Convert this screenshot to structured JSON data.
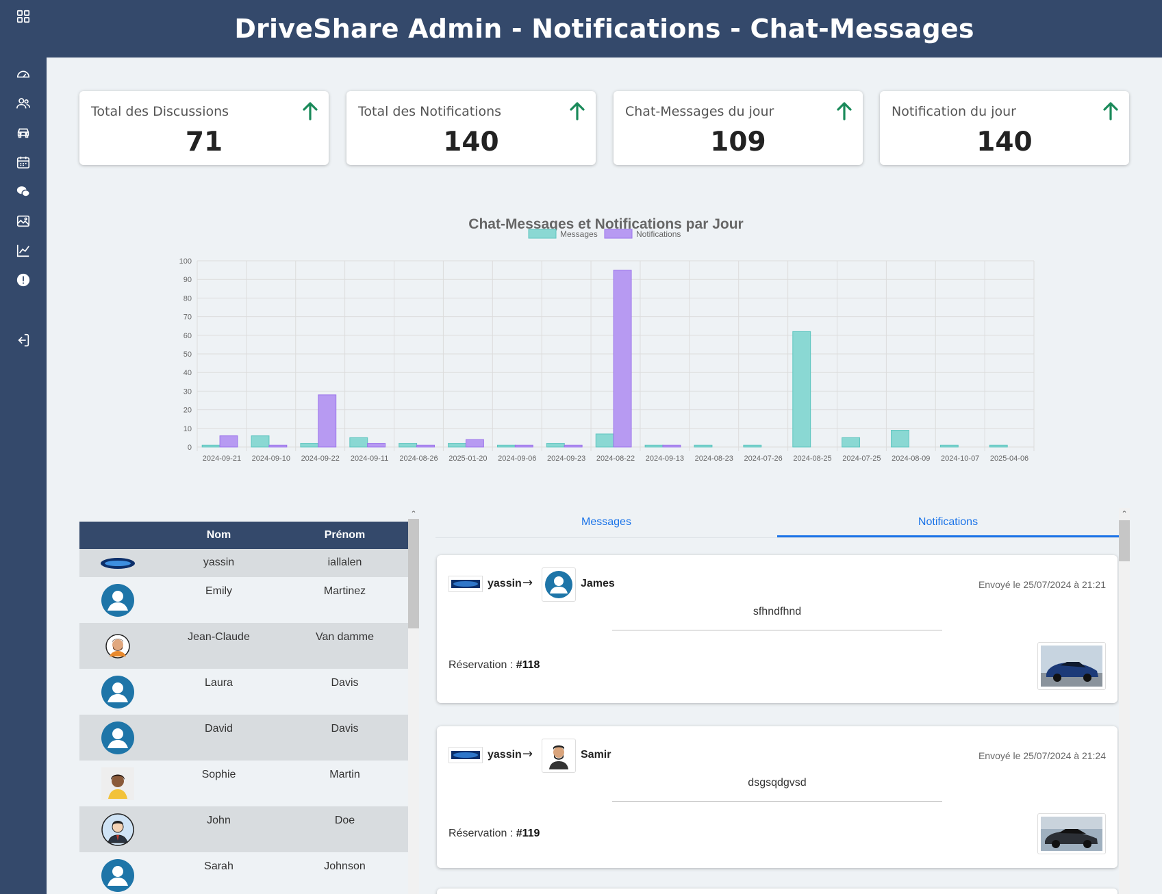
{
  "header": {
    "title": "DriveShare Admin - Notifications - Chat-Messages"
  },
  "sidebar": {
    "items": [
      {
        "icon": "grid-icon"
      },
      {
        "icon": "dashboard-icon"
      },
      {
        "icon": "users-icon"
      },
      {
        "icon": "car-icon"
      },
      {
        "icon": "calendar-icon"
      },
      {
        "icon": "chat-icon"
      },
      {
        "icon": "gallery-icon"
      },
      {
        "icon": "chart-icon"
      },
      {
        "icon": "alert-icon"
      },
      {
        "icon": "logout-icon"
      }
    ]
  },
  "stats": [
    {
      "label": "Total des Discussions",
      "value": "71"
    },
    {
      "label": "Total des Notifications",
      "value": "140"
    },
    {
      "label": "Chat-Messages du jour",
      "value": "109"
    },
    {
      "label": "Notification du jour",
      "value": "140"
    }
  ],
  "colors": {
    "header": "#34496b",
    "arrow_up": "#1a8a5a",
    "messages": "#8ad8d3",
    "notifications": "#b79af2",
    "tab_accent": "#1a73e8"
  },
  "chart_data": {
    "type": "bar",
    "title": "Chat-Messages et Notifications par Jour",
    "categories": [
      "2024-09-21",
      "2024-09-10",
      "2024-09-22",
      "2024-09-11",
      "2024-08-26",
      "2025-01-20",
      "2024-09-06",
      "2024-09-23",
      "2024-08-22",
      "2024-09-13",
      "2024-08-23",
      "2024-07-26",
      "2024-08-25",
      "2024-07-25",
      "2024-08-09",
      "2024-10-07",
      "2025-04-06"
    ],
    "series": [
      {
        "name": "Messages",
        "values": [
          1,
          6,
          2,
          5,
          2,
          2,
          1,
          2,
          7,
          1,
          1,
          1,
          62,
          5,
          9,
          1,
          1
        ]
      },
      {
        "name": "Notifications",
        "values": [
          6,
          1,
          28,
          2,
          1,
          4,
          1,
          1,
          95,
          1,
          0,
          0,
          0,
          0,
          0,
          0,
          0
        ]
      }
    ],
    "ylim": [
      0,
      100
    ],
    "yticks": [
      "0",
      "10",
      "20",
      "30",
      "40",
      "50",
      "60",
      "70",
      "80",
      "90",
      "100"
    ],
    "grid": true,
    "legend": "top-center"
  },
  "users_table": {
    "headers": {
      "avatar": "",
      "nom": "Nom",
      "prenom": "Prénom"
    },
    "rows": [
      {
        "nom": "yassin",
        "prenom": "iallalen",
        "avatar": "blue-lens-logo"
      },
      {
        "nom": "Emily",
        "prenom": "Martinez",
        "avatar": "default-user-icon"
      },
      {
        "nom": "Jean-Claude",
        "prenom": "Van damme",
        "avatar": "bearded-man-avatar"
      },
      {
        "nom": "Laura",
        "prenom": "Davis",
        "avatar": "default-user-icon"
      },
      {
        "nom": "David",
        "prenom": "Davis",
        "avatar": "default-user-icon"
      },
      {
        "nom": "Sophie",
        "prenom": "Martin",
        "avatar": "woman-avatar"
      },
      {
        "nom": "John",
        "prenom": "Doe",
        "avatar": "businessman-avatar"
      },
      {
        "nom": "Sarah",
        "prenom": "Johnson",
        "avatar": "default-user-icon"
      }
    ]
  },
  "tabs": {
    "messages": "Messages",
    "notifications": "Notifications",
    "active": "Notifications"
  },
  "notifications": [
    {
      "from": "yassin",
      "to": "James",
      "date": "Envoyé le 25/07/2024 à 21:21",
      "message": "sfhndfhnd",
      "reservation_label": "Réservation :",
      "reservation_id": "#118",
      "car_color": "blue"
    },
    {
      "from": "yassin",
      "to": "Samir",
      "date": "Envoyé le 25/07/2024 à 21:24",
      "message": "dsgsqdgvsd",
      "reservation_label": "Réservation :",
      "reservation_id": "#119",
      "car_color": "dark-gray"
    }
  ]
}
